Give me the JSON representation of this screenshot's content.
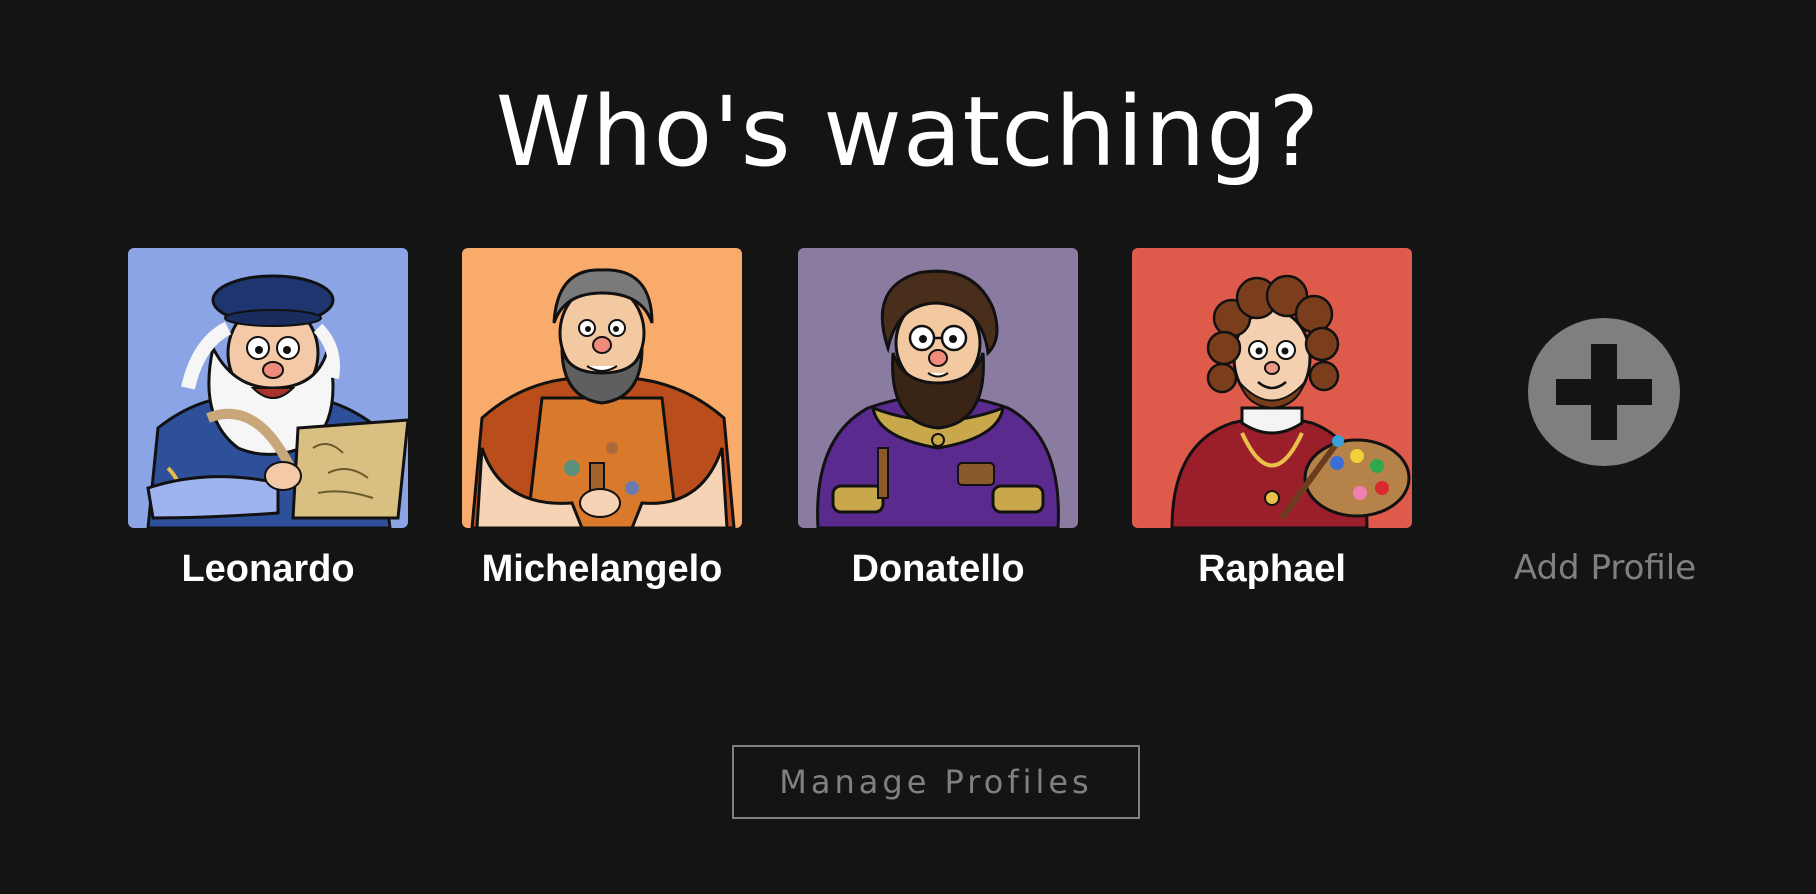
{
  "title": "Who's watching?",
  "profiles": [
    {
      "name": "Leonardo",
      "bg": "#8aa4e6"
    },
    {
      "name": "Michelangelo",
      "bg": "#f9ab6c"
    },
    {
      "name": "Donatello",
      "bg": "#8a7ca0"
    },
    {
      "name": "Raphael",
      "bg": "#de5a4a"
    }
  ],
  "add_profile": {
    "label": "Add Profile",
    "icon": "plus-icon"
  },
  "manage_button": {
    "label": "Manage Profiles"
  },
  "colors": {
    "background": "#141414",
    "text": "#ffffff",
    "muted": "#808080"
  }
}
